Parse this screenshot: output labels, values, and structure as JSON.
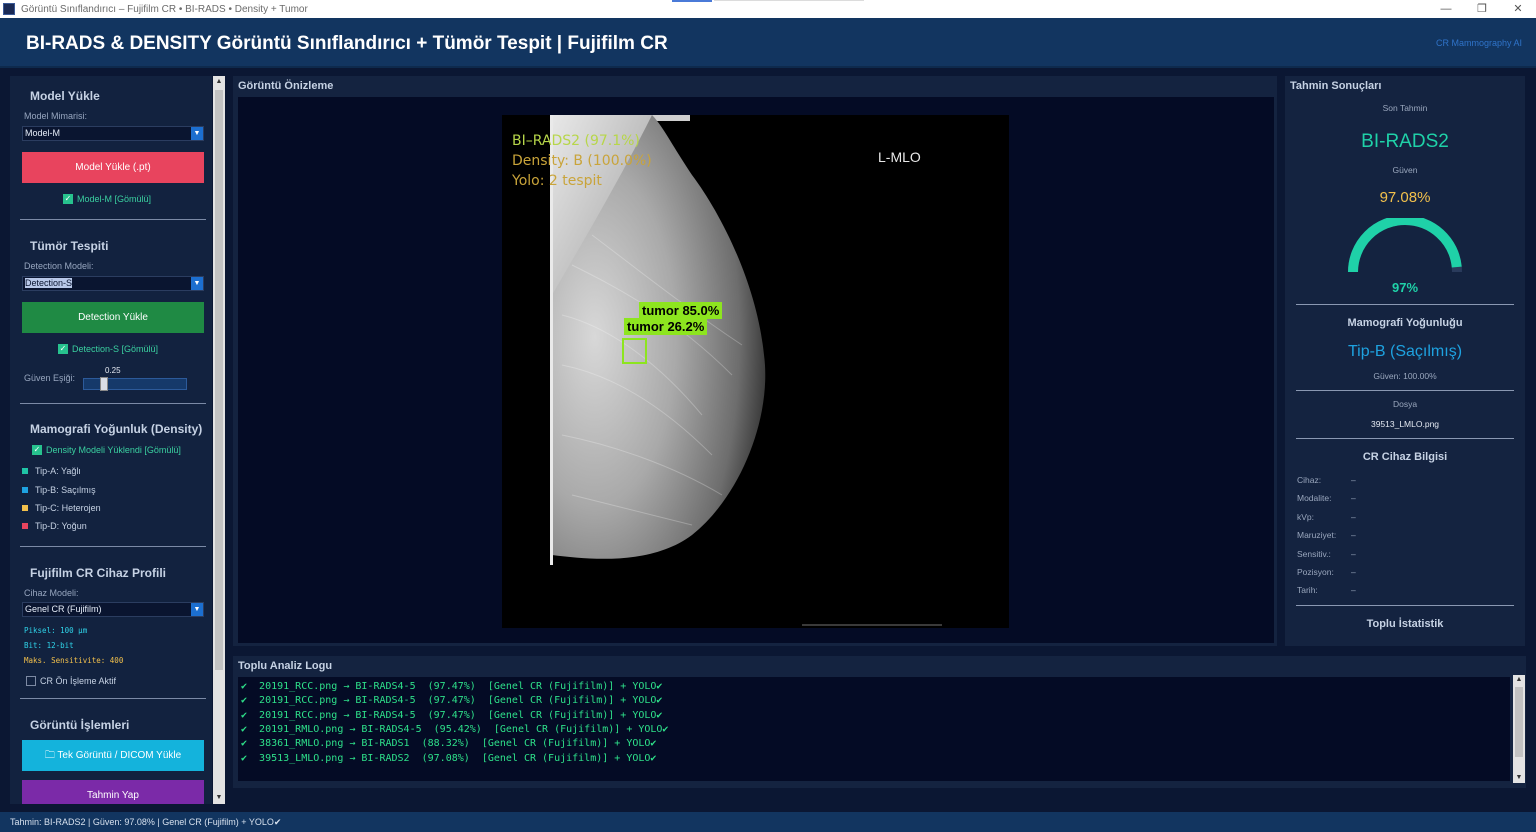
{
  "window": {
    "title": "Görüntü Sınıflandırıcı – Fujifilm CR  •  BI-RADS  •  Density + Tumor",
    "controls": [
      "—",
      "❐",
      "✕"
    ]
  },
  "header": {
    "title": "BI-RADS & DENSITY Görüntü Sınıflandırıcı + Tümör Tespit |  Fujifilm CR",
    "tag": "CR Mammography AI"
  },
  "sidebar": {
    "model": {
      "title": "Model Yükle",
      "arch_label": "Model Mimarisi:",
      "arch_value": "Model-M",
      "load_button": "Model Yükle (.pt)",
      "embedded": "Model-M [Gömülü]"
    },
    "tumor": {
      "title": "Tümör Tespiti",
      "det_label": "Detection Modeli:",
      "det_value": "Detection-S",
      "load_button": "Detection Yükle",
      "embedded": "Detection-S [Gömülü]",
      "threshold_label": "Güven Eşiği:",
      "threshold_value": "0.25",
      "threshold": 0.25
    },
    "density": {
      "title": "Mamografi Yoğunluk (Density)",
      "loaded": "Density Modeli Yüklendi [Gömülü]",
      "legend": [
        {
          "label": "Tip-A: Yağlı",
          "color": "#1fc4a6"
        },
        {
          "label": "Tip-B: Saçılmış",
          "color": "#1ea2e0"
        },
        {
          "label": "Tip-C: Heterojen",
          "color": "#f2c04c"
        },
        {
          "label": "Tip-D: Yoğun",
          "color": "#e8445e"
        }
      ]
    },
    "device": {
      "title": "Fujifilm CR Cihaz Profili",
      "model_label": "Cihaz Modeli:",
      "model_value": "Genel CR (Fujifilm)",
      "pixel": "Piksel: 100 µm",
      "bit": "Bit: 12-bit",
      "sens": "Maks. Sensitivite: 400",
      "preprocess": "CR Ön İşleme Aktif"
    },
    "image_ops": {
      "title": "Görüntü İşlemleri",
      "load_button": "Tek Görüntü / DICOM Yükle",
      "predict_button": "Tahmin Yap"
    }
  },
  "preview": {
    "title": "Görüntü Önizleme",
    "overlay_birads": "BI–RADS2 (97.1%)",
    "overlay_density": "Density: B (100.0%)",
    "overlay_yolo": "Yolo: 2 tespit",
    "view_label": "L-MLO",
    "detections": [
      {
        "label": "tumor  85.0%"
      },
      {
        "label": "tumor  26.2%"
      }
    ]
  },
  "results": {
    "title": "Tahmin Sonuçları",
    "last_label": "Son Tahmin",
    "prediction": "BI-RADS2",
    "conf_label": "Güven",
    "confidence": "97.08%",
    "gauge_value": 0.97,
    "gauge_text": "97%",
    "density_title": "Mamografi Yoğunluğu",
    "density_value": "Tip-B  (Saçılmış)",
    "density_conf": "Güven: 100.00%",
    "file_label": "Dosya",
    "file_name": "39513_LMLO.png",
    "device_title": "CR Cihaz Bilgisi",
    "device_rows": [
      {
        "key": "Cihaz:",
        "val": "–"
      },
      {
        "key": "Modalite:",
        "val": "–"
      },
      {
        "key": "kVp:",
        "val": "–"
      },
      {
        "key": "Maruziyet:",
        "val": "–"
      },
      {
        "key": "Sensitiv.:",
        "val": "–"
      },
      {
        "key": "Pozisyon:",
        "val": "–"
      },
      {
        "key": "Tarih:",
        "val": "–"
      }
    ],
    "batch_title": "Toplu İstatistik"
  },
  "log": {
    "title": "Toplu Analiz Logu",
    "lines": [
      "✔  20191_RCC.png → BI-RADS4-5  (97.47%)  [Genel CR (Fujifilm)] + YOLO✔",
      "✔  20191_RCC.png → BI-RADS4-5  (97.47%)  [Genel CR (Fujifilm)] + YOLO✔",
      "✔  20191_RCC.png → BI-RADS4-5  (97.47%)  [Genel CR (Fujifilm)] + YOLO✔",
      "✔  20191_RMLO.png → BI-RADS4-5  (95.42%)  [Genel CR (Fujifilm)] + YOLO✔",
      "✔  38361_RMLO.png → BI-RADS1  (88.32%)  [Genel CR (Fujifilm)] + YOLO✔",
      "✔  39513_LMLO.png → BI-RADS2  (97.08%)  [Genel CR (Fujifilm)] + YOLO✔"
    ]
  },
  "status": "Tahmin: BI-RADS2  |  Güven: 97.08%  |  Genel CR (Fujifilm) + YOLO✔",
  "colors": {
    "accent_teal": "#1fd1a8",
    "birads_text": "#1fd1a8",
    "confidence_text": "#f2c04c",
    "density_text": "#1ea2e0",
    "detection_green": "#8de51f"
  }
}
